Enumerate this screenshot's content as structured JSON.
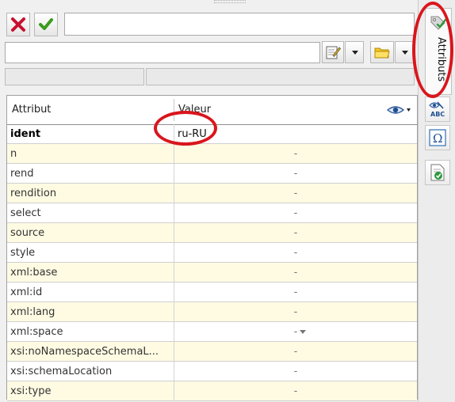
{
  "toolbar": {
    "cancel_icon": "red-x-icon",
    "confirm_icon": "green-check-icon",
    "value_input": "",
    "second_input": "",
    "edit_icon": "edit-note-icon",
    "folder_icon": "folder-icon"
  },
  "side": {
    "tab_label": "Attributs",
    "buttons": [
      "spellcheck-abc-icon",
      "omega-symbol-icon",
      "document-check-icon"
    ]
  },
  "table": {
    "header_attribute": "Attribut",
    "header_value": "Valeur",
    "rows": [
      {
        "name": "ident",
        "value": "ru-RU",
        "bold": true
      },
      {
        "name": "n",
        "value": "-"
      },
      {
        "name": "rend",
        "value": "-"
      },
      {
        "name": "rendition",
        "value": "-"
      },
      {
        "name": "select",
        "value": "-"
      },
      {
        "name": "source",
        "value": "-"
      },
      {
        "name": "style",
        "value": "-"
      },
      {
        "name": "xml:base",
        "value": "-"
      },
      {
        "name": "xml:id",
        "value": "-"
      },
      {
        "name": "xml:lang",
        "value": "-"
      },
      {
        "name": "xml:space",
        "value": "-"
      },
      {
        "name": "xsi:noNamespaceSchemaL...",
        "value": "-"
      },
      {
        "name": "xsi:schemaLocation",
        "value": "-"
      },
      {
        "name": "xsi:type",
        "value": "-"
      }
    ]
  },
  "colors": {
    "alt_row": "#fffbe3",
    "annotation": "#d9161c"
  }
}
